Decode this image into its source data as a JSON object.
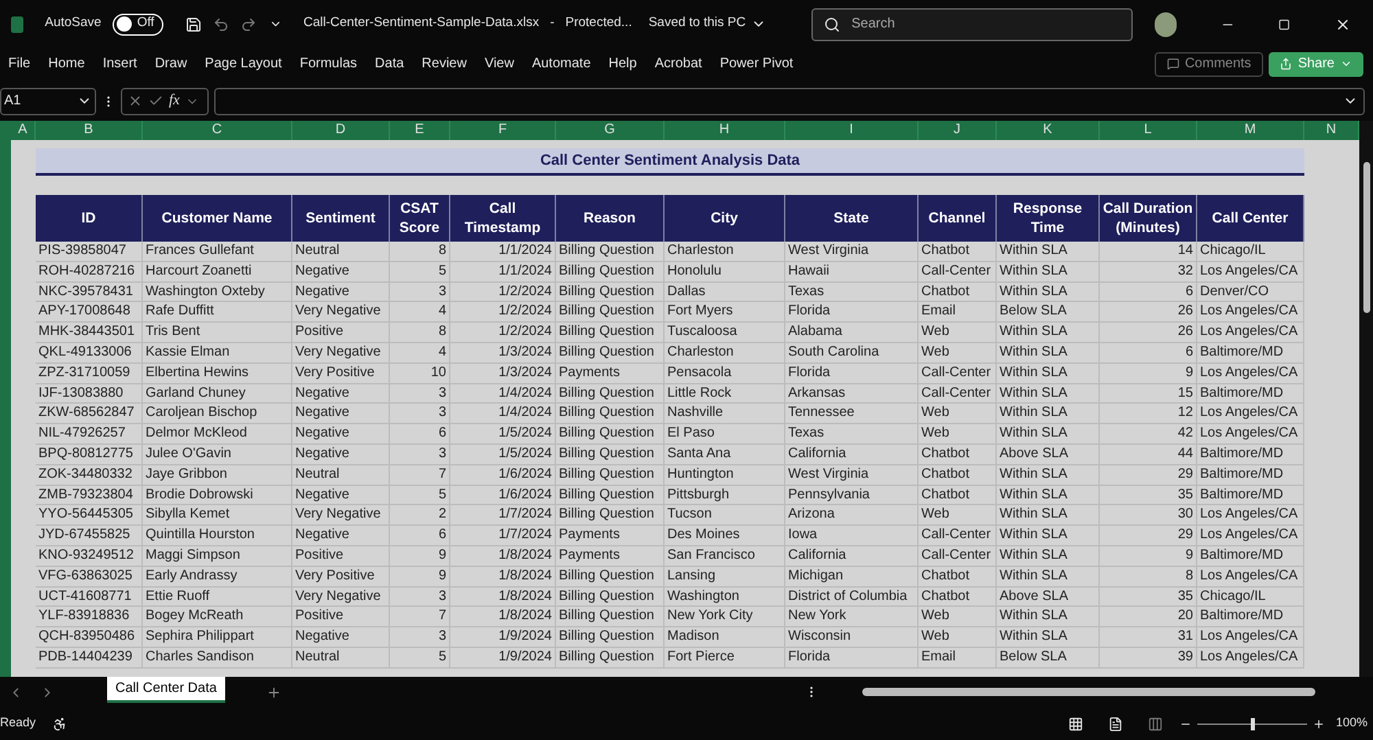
{
  "title_bar": {
    "autosave_label": "AutoSave",
    "autosave": {
      "on": false,
      "label": "Off"
    },
    "file_name": "Call-Center-Sentiment-Sample-Data.xlsx",
    "separator": "-",
    "protection": "Protected...",
    "save_state": "Saved to this PC",
    "search": {
      "placeholder": "Search"
    }
  },
  "ribbon_tabs": [
    {
      "label": "File",
      "selected": false
    },
    {
      "label": "Home",
      "selected": false
    },
    {
      "label": "Insert",
      "selected": false
    },
    {
      "label": "Draw",
      "selected": false
    },
    {
      "label": "Page Layout",
      "selected": false
    },
    {
      "label": "Formulas",
      "selected": false
    },
    {
      "label": "Data",
      "selected": false
    },
    {
      "label": "Review",
      "selected": false
    },
    {
      "label": "View",
      "selected": false
    },
    {
      "label": "Automate",
      "selected": false
    },
    {
      "label": "Help",
      "selected": false
    },
    {
      "label": "Acrobat",
      "selected": false
    },
    {
      "label": "Power Pivot",
      "selected": false
    }
  ],
  "ribbon_buttons": {
    "comments": "Comments",
    "share": "Share"
  },
  "formula_bar": {
    "name_box": "A1",
    "function_label": "fx"
  },
  "column_letters": [
    "A",
    "B",
    "C",
    "D",
    "E",
    "F",
    "G",
    "H",
    "I",
    "J",
    "K",
    "L",
    "M",
    "N"
  ],
  "sheet_title": "Call Center Sentiment Analysis Data",
  "table": {
    "columns": [
      {
        "label": "ID",
        "kind": "text"
      },
      {
        "label": "Customer Name",
        "kind": "text"
      },
      {
        "label": "Sentiment",
        "kind": "text"
      },
      {
        "label": "CSAT Score",
        "kind": "number"
      },
      {
        "label": "Call Timestamp",
        "kind": "number"
      },
      {
        "label": "Reason",
        "kind": "text"
      },
      {
        "label": "City",
        "kind": "text"
      },
      {
        "label": "State",
        "kind": "text"
      },
      {
        "label": "Channel",
        "kind": "text"
      },
      {
        "label": "Response Time",
        "kind": "text"
      },
      {
        "label": "Call Duration (Minutes)",
        "kind": "number"
      },
      {
        "label": "Call Center",
        "kind": "text"
      }
    ],
    "rows": [
      [
        "PIS-39858047",
        "Frances Gullefant",
        "Neutral",
        "8",
        "1/1/2024",
        "Billing Question",
        "Charleston",
        "West Virginia",
        "Chatbot",
        "Within SLA",
        "14",
        "Chicago/IL"
      ],
      [
        "ROH-40287216",
        "Harcourt Zoanetti",
        "Negative",
        "5",
        "1/1/2024",
        "Billing Question",
        "Honolulu",
        "Hawaii",
        "Call-Center",
        "Within SLA",
        "32",
        "Los Angeles/CA"
      ],
      [
        "NKC-39578431",
        "Washington Oxteby",
        "Negative",
        "3",
        "1/2/2024",
        "Billing Question",
        "Dallas",
        "Texas",
        "Chatbot",
        "Within SLA",
        "6",
        "Denver/CO"
      ],
      [
        "APY-17008648",
        "Rafe Duffitt",
        "Very Negative",
        "4",
        "1/2/2024",
        "Billing Question",
        "Fort Myers",
        "Florida",
        "Email",
        "Below SLA",
        "26",
        "Los Angeles/CA"
      ],
      [
        "MHK-38443501",
        "Tris Bent",
        "Positive",
        "8",
        "1/2/2024",
        "Billing Question",
        "Tuscaloosa",
        "Alabama",
        "Web",
        "Within SLA",
        "26",
        "Los Angeles/CA"
      ],
      [
        "QKL-49133006",
        "Kassie Elman",
        "Very Negative",
        "4",
        "1/3/2024",
        "Billing Question",
        "Charleston",
        "South Carolina",
        "Web",
        "Within SLA",
        "6",
        "Baltimore/MD"
      ],
      [
        "ZPZ-31710059",
        "Elbertina Hewins",
        "Very Positive",
        "10",
        "1/3/2024",
        "Payments",
        "Pensacola",
        "Florida",
        "Call-Center",
        "Within SLA",
        "9",
        "Los Angeles/CA"
      ],
      [
        "IJF-13083880",
        "Garland Chuney",
        "Negative",
        "3",
        "1/4/2024",
        "Billing Question",
        "Little Rock",
        "Arkansas",
        "Call-Center",
        "Within SLA",
        "15",
        "Baltimore/MD"
      ],
      [
        "ZKW-68562847",
        "Caroljean Bischop",
        "Negative",
        "3",
        "1/4/2024",
        "Billing Question",
        "Nashville",
        "Tennessee",
        "Web",
        "Within SLA",
        "12",
        "Los Angeles/CA"
      ],
      [
        "NIL-47926257",
        "Delmor McKleod",
        "Negative",
        "6",
        "1/5/2024",
        "Billing Question",
        "El Paso",
        "Texas",
        "Web",
        "Within SLA",
        "42",
        "Los Angeles/CA"
      ],
      [
        "BPQ-80812775",
        "Julee O'Gavin",
        "Negative",
        "3",
        "1/5/2024",
        "Billing Question",
        "Santa Ana",
        "California",
        "Chatbot",
        "Above SLA",
        "44",
        "Baltimore/MD"
      ],
      [
        "ZOK-34480332",
        "Jaye Gribbon",
        "Neutral",
        "7",
        "1/6/2024",
        "Billing Question",
        "Huntington",
        "West Virginia",
        "Chatbot",
        "Within SLA",
        "29",
        "Baltimore/MD"
      ],
      [
        "ZMB-79323804",
        "Brodie Dobrowski",
        "Negative",
        "5",
        "1/6/2024",
        "Billing Question",
        "Pittsburgh",
        "Pennsylvania",
        "Chatbot",
        "Within SLA",
        "35",
        "Baltimore/MD"
      ],
      [
        "YYO-56445305",
        "Sibylla Kemet",
        "Very Negative",
        "2",
        "1/7/2024",
        "Billing Question",
        "Tucson",
        "Arizona",
        "Web",
        "Within SLA",
        "30",
        "Los Angeles/CA"
      ],
      [
        "JYD-67455825",
        "Quintilla Hourston",
        "Negative",
        "6",
        "1/7/2024",
        "Payments",
        "Des Moines",
        "Iowa",
        "Call-Center",
        "Within SLA",
        "29",
        "Los Angeles/CA"
      ],
      [
        "KNO-93249512",
        "Maggi Simpson",
        "Positive",
        "9",
        "1/8/2024",
        "Payments",
        "San Francisco",
        "California",
        "Call-Center",
        "Within SLA",
        "9",
        "Baltimore/MD"
      ],
      [
        "VFG-63863025",
        "Early Andrassy",
        "Very Positive",
        "9",
        "1/8/2024",
        "Billing Question",
        "Lansing",
        "Michigan",
        "Chatbot",
        "Within SLA",
        "8",
        "Los Angeles/CA"
      ],
      [
        "UCT-41608771",
        "Ettie Ruoff",
        "Very Negative",
        "3",
        "1/8/2024",
        "Billing Question",
        "Washington",
        "District of Columbia",
        "Chatbot",
        "Above SLA",
        "35",
        "Chicago/IL"
      ],
      [
        "YLF-83918836",
        "Bogey McReath",
        "Positive",
        "7",
        "1/8/2024",
        "Billing Question",
        "New York City",
        "New York",
        "Web",
        "Within SLA",
        "20",
        "Baltimore/MD"
      ],
      [
        "QCH-83950486",
        "Sephira Philippart",
        "Negative",
        "3",
        "1/9/2024",
        "Billing Question",
        "Madison",
        "Wisconsin",
        "Web",
        "Within SLA",
        "31",
        "Los Angeles/CA"
      ],
      [
        "PDB-14404239",
        "Charles Sandison",
        "Neutral",
        "5",
        "1/9/2024",
        "Billing Question",
        "Fort Pierce",
        "Florida",
        "Email",
        "Below SLA",
        "39",
        "Los Angeles/CA"
      ]
    ]
  },
  "sheet_tabs": [
    {
      "label": "Call Center Data",
      "selected": true
    }
  ],
  "status_bar": {
    "status": "Ready",
    "zoom": {
      "level": 0.5,
      "label": "100%"
    }
  }
}
